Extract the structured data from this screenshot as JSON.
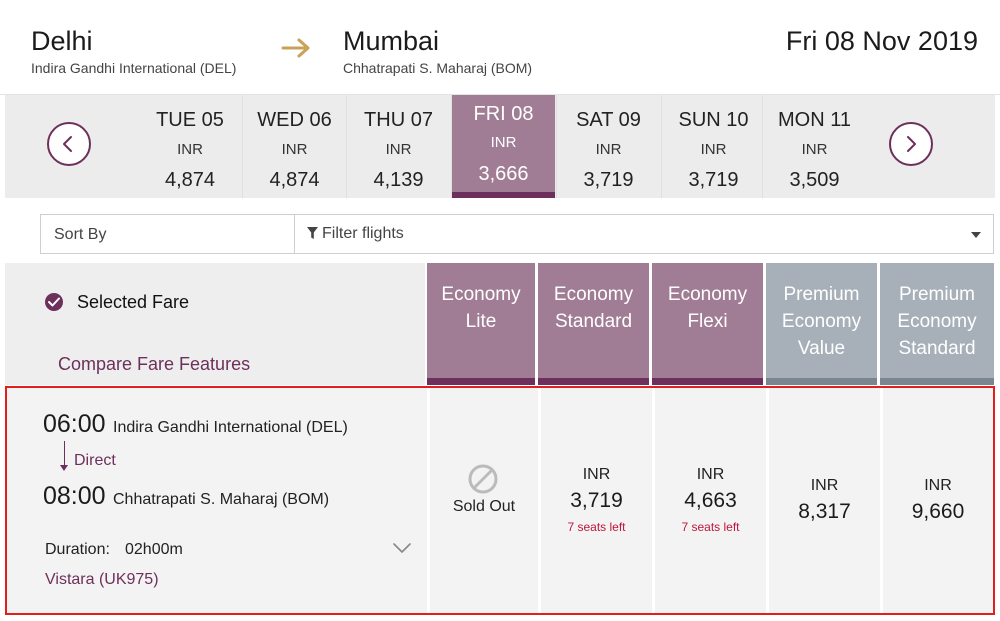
{
  "header": {
    "origin_city": "Delhi",
    "origin_airport": "Indira Gandhi International (DEL)",
    "dest_city": "Mumbai",
    "dest_airport": "Chhatrapati S. Maharaj (BOM)",
    "date": "Fri 08 Nov 2019",
    "arrow_icon": "right-arrow-icon",
    "accent_color": "#c9a15a"
  },
  "date_strip": {
    "days": [
      {
        "label": "TUE 05",
        "currency": "INR",
        "price": "4,874"
      },
      {
        "label": "WED 06",
        "currency": "INR",
        "price": "4,874"
      },
      {
        "label": "THU 07",
        "currency": "INR",
        "price": "4,139"
      },
      {
        "label": "FRI 08",
        "currency": "INR",
        "price": "3,666"
      },
      {
        "label": "SAT 09",
        "currency": "INR",
        "price": "3,719"
      },
      {
        "label": "SUN 10",
        "currency": "INR",
        "price": "3,719"
      },
      {
        "label": "MON 11",
        "currency": "INR",
        "price": "3,509"
      }
    ],
    "selected_index": 3,
    "prev_icon": "chevron-left-icon",
    "next_icon": "chevron-right-icon"
  },
  "toolbar": {
    "sort_label": "Sort By",
    "filter_label": "Filter flights",
    "filter_icon": "funnel-icon"
  },
  "fare_header": {
    "selected_fare_label": "Selected Fare",
    "compare_link": "Compare Fare Features",
    "columns": [
      {
        "line1": "Economy",
        "line2": "Lite",
        "line3": ""
      },
      {
        "line1": "Economy",
        "line2": "Standard",
        "line3": ""
      },
      {
        "line1": "Economy",
        "line2": "Flexi",
        "line3": ""
      },
      {
        "line1": "Premium",
        "line2": "Economy",
        "line3": "Value"
      },
      {
        "line1": "Premium",
        "line2": "Economy",
        "line3": "Standard"
      }
    ]
  },
  "flight": {
    "dep_time": "06:00",
    "dep_airport": "Indira Gandhi International (DEL)",
    "stop_type": "Direct",
    "arr_time": "08:00",
    "arr_airport": "Chhatrapati S. Maharaj (BOM)",
    "duration_label": "Duration:",
    "duration_value": "02h00m",
    "airline": "Vistara (UK975)",
    "fares": [
      {
        "status": "Sold Out"
      },
      {
        "currency": "INR",
        "amount": "3,719",
        "seats": "7 seats left"
      },
      {
        "currency": "INR",
        "amount": "4,663",
        "seats": "7 seats left"
      },
      {
        "currency": "INR",
        "amount": "8,317"
      },
      {
        "currency": "INR",
        "amount": "9,660"
      }
    ]
  },
  "colors": {
    "brand": "#6d2f5c",
    "economy": "#a07d95",
    "premium": "#a7b0b9",
    "seats_warning": "#c0143c",
    "highlight_border": "#e0201f"
  }
}
